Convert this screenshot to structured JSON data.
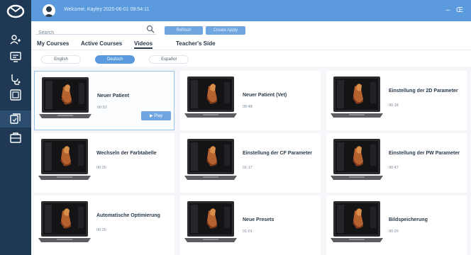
{
  "titlebar": {
    "welcome": "Welcome, Kayley   2020-06-01 09:54:11",
    "window_controls": "– Œ"
  },
  "search": {
    "placeholder": "Search",
    "refresh_label": "Refresh",
    "create_label": "Create Apply"
  },
  "tabs": [
    {
      "label": "My Courses"
    },
    {
      "label": "Active Courses"
    },
    {
      "label": "Videos"
    },
    {
      "label": "Teacher's Side"
    }
  ],
  "languages": [
    {
      "label": "English"
    },
    {
      "label": "Deutsch"
    },
    {
      "label": "Español"
    }
  ],
  "videos": [
    {
      "title": "Neuer Patient",
      "duration": "00:52"
    },
    {
      "title": "Neuer Patient (Vet)",
      "duration": "00:48"
    },
    {
      "title": "Einstellung der 2D Parameter",
      "duration": "00:18"
    },
    {
      "title": "Wechseln der Farbtabelle",
      "duration": "00:26"
    },
    {
      "title": "Einstellung der CF Parameter",
      "duration": "01:17"
    },
    {
      "title": "Einstellung der PW Parameter",
      "duration": "00:47"
    },
    {
      "title": "Automatische Optimierung",
      "duration": "00:26"
    },
    {
      "title": "Neue Presets",
      "duration": "01:01"
    },
    {
      "title": "Bildspeicherung",
      "duration": "00:20"
    }
  ],
  "play_label": "▶  Play",
  "colors": {
    "accent": "#5b9bdd",
    "sidebar": "#1f3954",
    "button": "#6fa6e0"
  },
  "icons": {
    "sidebar": [
      "logo-icon",
      "users-icon",
      "monitor-icon",
      "stethoscope-icon",
      "image-icon",
      "video-icon",
      "briefcase-icon"
    ]
  }
}
